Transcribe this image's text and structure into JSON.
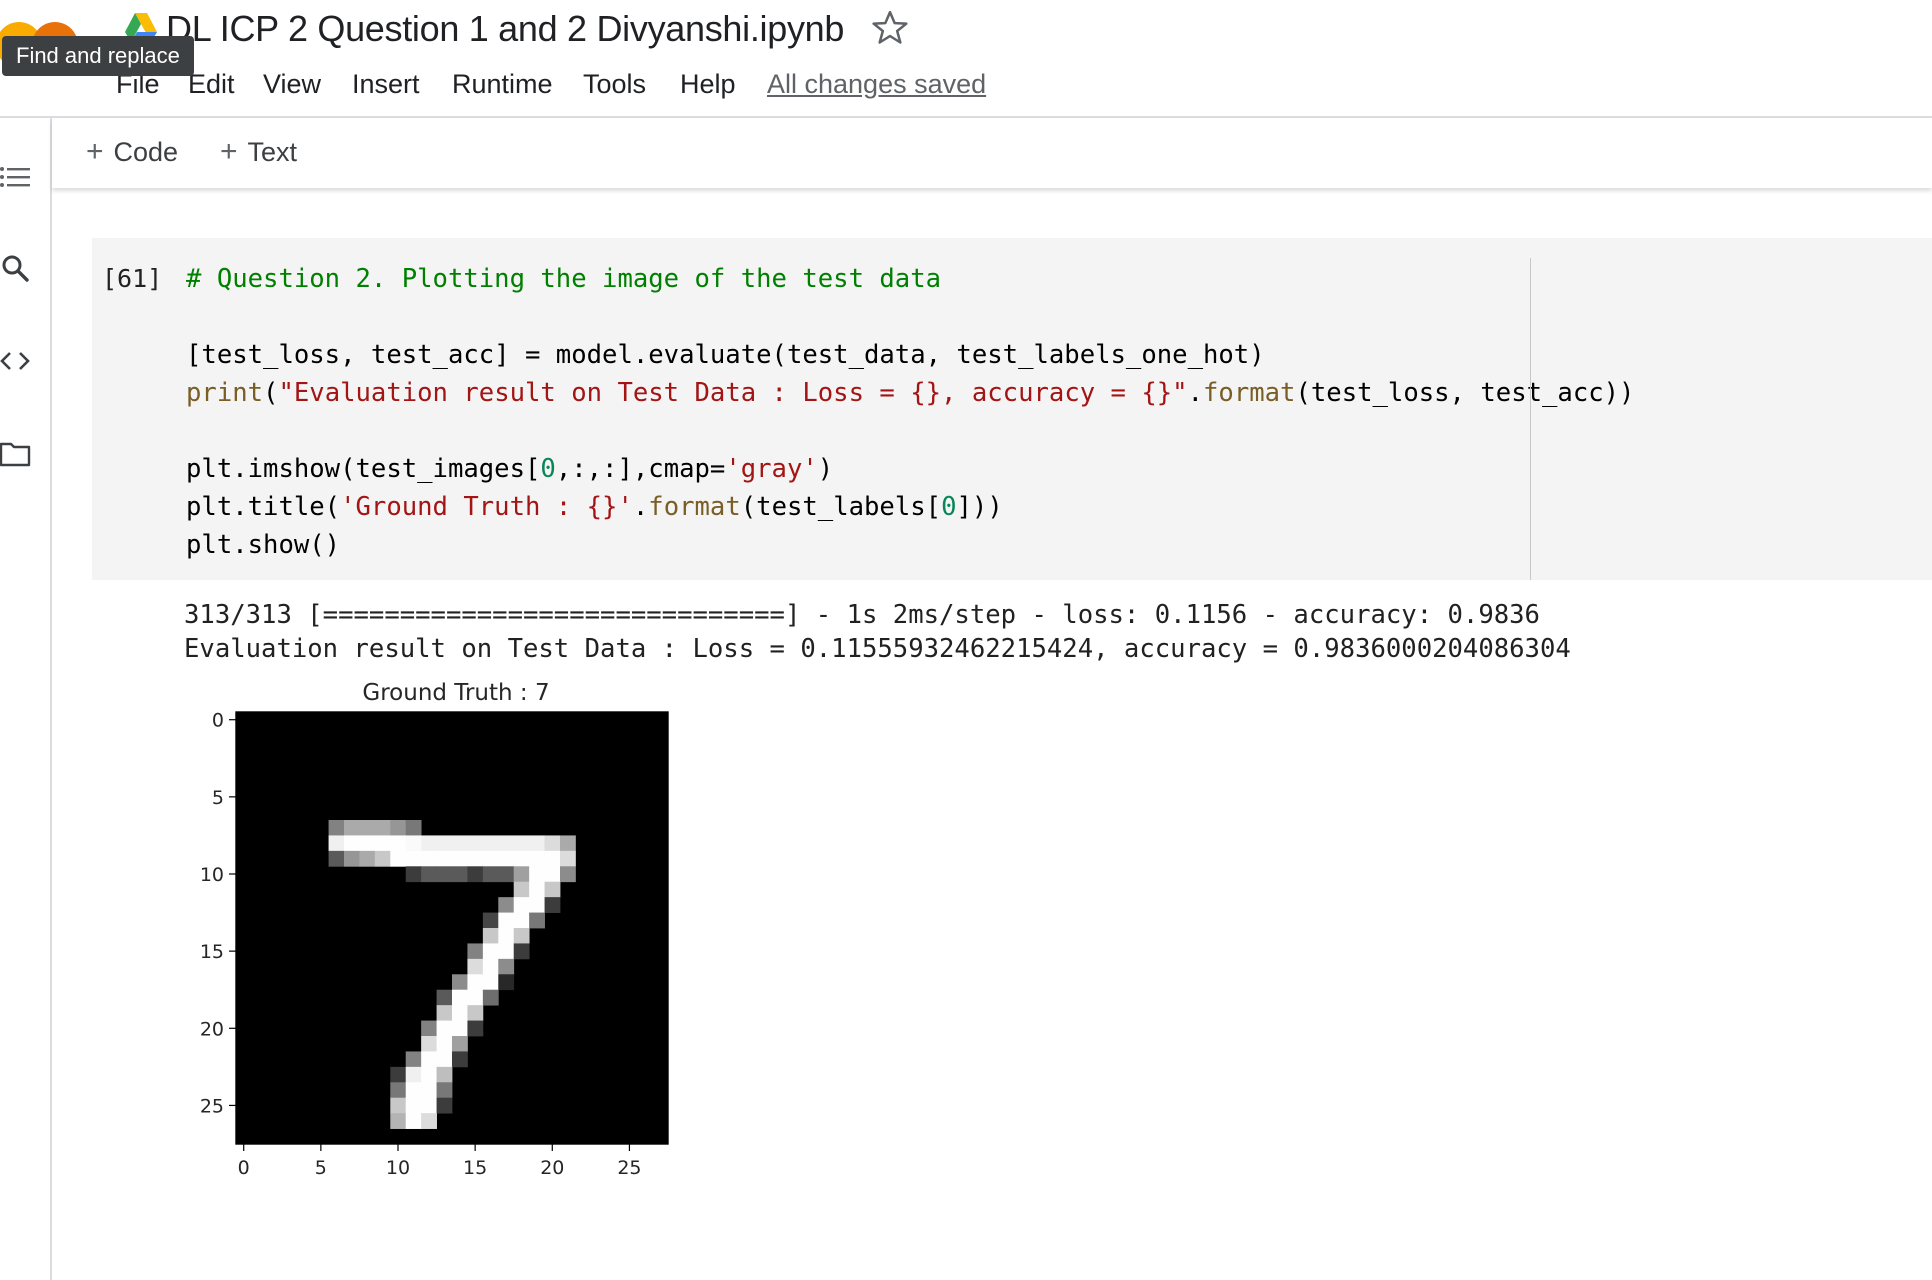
{
  "app": {
    "notebook_title": "DL ICP 2 Question 1 and 2 Divyanshi.ipynb",
    "tooltip": "Find and replace"
  },
  "menu": {
    "items": [
      "File",
      "Edit",
      "View",
      "Insert",
      "Runtime",
      "Tools",
      "Help"
    ],
    "status": "All changes saved"
  },
  "toolbar": {
    "code_label": "Code",
    "text_label": "Text"
  },
  "sidebar": {
    "icons": [
      "table-of-contents-icon",
      "search-icon",
      "code-snippets-icon",
      "files-folder-icon"
    ]
  },
  "cell": {
    "execution_count": "[61]",
    "code_lines": [
      "# Question 2. Plotting the image of the test data",
      "",
      "[test_loss, test_acc] = model.evaluate(test_data, test_labels_one_hot)",
      "print(\"Evaluation result on Test Data : Loss = {}, accuracy = {}\".format(test_loss, test_acc))",
      "",
      "plt.imshow(test_images[0,:,:],cmap='gray')",
      "plt.title('Ground Truth : {}'.format(test_labels[0]))",
      "plt.show()"
    ]
  },
  "output": {
    "lines": [
      "313/313 [==============================] - 1s 2ms/step - loss: 0.1156 - accuracy: 0.9836",
      "Evaluation result on Test Data : Loss = 0.11555932462215424, accuracy = 0.9836000204086304"
    ]
  },
  "chart_data": {
    "type": "heatmap",
    "title": "Ground Truth : 7",
    "xlabel": "",
    "ylabel": "",
    "colormap": "gray",
    "xlim": [
      -0.5,
      27.5
    ],
    "ylim": [
      27.5,
      -0.5
    ],
    "xticks": [
      0,
      5,
      10,
      15,
      20,
      25
    ],
    "yticks": [
      0,
      5,
      10,
      15,
      20,
      25
    ],
    "grid": false,
    "shape": [
      28,
      28
    ],
    "background": 0,
    "pixels": [
      [
        7,
        6,
        130
      ],
      [
        7,
        7,
        170
      ],
      [
        7,
        8,
        170
      ],
      [
        7,
        9,
        170
      ],
      [
        7,
        10,
        150
      ],
      [
        7,
        11,
        120
      ],
      [
        8,
        6,
        240
      ],
      [
        8,
        7,
        254
      ],
      [
        8,
        8,
        254
      ],
      [
        8,
        9,
        254
      ],
      [
        8,
        10,
        254
      ],
      [
        8,
        11,
        250
      ],
      [
        8,
        12,
        240
      ],
      [
        8,
        13,
        240
      ],
      [
        8,
        14,
        240
      ],
      [
        8,
        15,
        240
      ],
      [
        8,
        16,
        240
      ],
      [
        8,
        17,
        240
      ],
      [
        8,
        18,
        240
      ],
      [
        8,
        19,
        240
      ],
      [
        8,
        20,
        220
      ],
      [
        8,
        21,
        170
      ],
      [
        9,
        6,
        90
      ],
      [
        9,
        7,
        150
      ],
      [
        9,
        8,
        170
      ],
      [
        9,
        9,
        200
      ],
      [
        9,
        10,
        254
      ],
      [
        9,
        11,
        254
      ],
      [
        9,
        12,
        254
      ],
      [
        9,
        13,
        254
      ],
      [
        9,
        14,
        254
      ],
      [
        9,
        15,
        254
      ],
      [
        9,
        16,
        254
      ],
      [
        9,
        17,
        254
      ],
      [
        9,
        18,
        254
      ],
      [
        9,
        19,
        254
      ],
      [
        9,
        20,
        254
      ],
      [
        9,
        21,
        220
      ],
      [
        10,
        11,
        60
      ],
      [
        10,
        12,
        90
      ],
      [
        10,
        13,
        90
      ],
      [
        10,
        14,
        90
      ],
      [
        10,
        15,
        60
      ],
      [
        10,
        16,
        90
      ],
      [
        10,
        17,
        90
      ],
      [
        10,
        18,
        160
      ],
      [
        10,
        19,
        254
      ],
      [
        10,
        20,
        254
      ],
      [
        10,
        21,
        140
      ],
      [
        11,
        18,
        200
      ],
      [
        11,
        19,
        254
      ],
      [
        11,
        20,
        200
      ],
      [
        12,
        17,
        140
      ],
      [
        12,
        18,
        254
      ],
      [
        12,
        19,
        254
      ],
      [
        12,
        20,
        60
      ],
      [
        13,
        16,
        70
      ],
      [
        13,
        17,
        254
      ],
      [
        13,
        18,
        254
      ],
      [
        13,
        19,
        120
      ],
      [
        14,
        16,
        200
      ],
      [
        14,
        17,
        254
      ],
      [
        14,
        18,
        200
      ],
      [
        15,
        15,
        130
      ],
      [
        15,
        16,
        254
      ],
      [
        15,
        17,
        254
      ],
      [
        15,
        18,
        60
      ],
      [
        16,
        15,
        220
      ],
      [
        16,
        16,
        254
      ],
      [
        16,
        17,
        140
      ],
      [
        17,
        14,
        140
      ],
      [
        17,
        15,
        254
      ],
      [
        17,
        16,
        254
      ],
      [
        17,
        17,
        40
      ],
      [
        18,
        13,
        90
      ],
      [
        18,
        14,
        254
      ],
      [
        18,
        15,
        254
      ],
      [
        18,
        16,
        110
      ],
      [
        19,
        13,
        200
      ],
      [
        19,
        14,
        254
      ],
      [
        19,
        15,
        200
      ],
      [
        20,
        12,
        130
      ],
      [
        20,
        13,
        254
      ],
      [
        20,
        14,
        254
      ],
      [
        20,
        15,
        60
      ],
      [
        21,
        12,
        220
      ],
      [
        21,
        13,
        254
      ],
      [
        21,
        14,
        160
      ],
      [
        22,
        11,
        130
      ],
      [
        22,
        12,
        254
      ],
      [
        22,
        13,
        254
      ],
      [
        22,
        14,
        60
      ],
      [
        23,
        10,
        60
      ],
      [
        23,
        11,
        240
      ],
      [
        23,
        12,
        254
      ],
      [
        23,
        13,
        190
      ],
      [
        24,
        10,
        120
      ],
      [
        24,
        11,
        254
      ],
      [
        24,
        12,
        254
      ],
      [
        24,
        13,
        120
      ],
      [
        25,
        10,
        200
      ],
      [
        25,
        11,
        254
      ],
      [
        25,
        12,
        254
      ],
      [
        25,
        13,
        60
      ],
      [
        26,
        10,
        180
      ],
      [
        26,
        11,
        254
      ],
      [
        26,
        12,
        220
      ]
    ]
  }
}
